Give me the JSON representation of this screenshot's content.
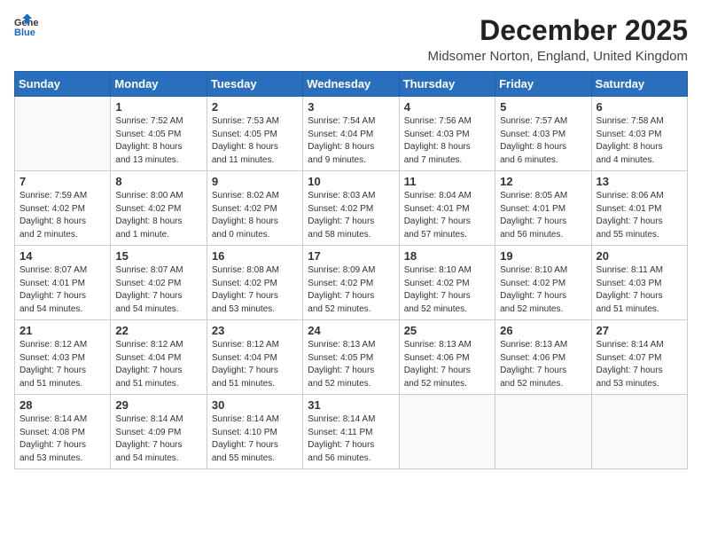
{
  "logo": {
    "general": "General",
    "blue": "Blue"
  },
  "header": {
    "month": "December 2025",
    "location": "Midsomer Norton, England, United Kingdom"
  },
  "weekdays": [
    "Sunday",
    "Monday",
    "Tuesday",
    "Wednesday",
    "Thursday",
    "Friday",
    "Saturday"
  ],
  "weeks": [
    [
      {
        "date": "",
        "info": ""
      },
      {
        "date": "1",
        "info": "Sunrise: 7:52 AM\nSunset: 4:05 PM\nDaylight: 8 hours\nand 13 minutes."
      },
      {
        "date": "2",
        "info": "Sunrise: 7:53 AM\nSunset: 4:05 PM\nDaylight: 8 hours\nand 11 minutes."
      },
      {
        "date": "3",
        "info": "Sunrise: 7:54 AM\nSunset: 4:04 PM\nDaylight: 8 hours\nand 9 minutes."
      },
      {
        "date": "4",
        "info": "Sunrise: 7:56 AM\nSunset: 4:03 PM\nDaylight: 8 hours\nand 7 minutes."
      },
      {
        "date": "5",
        "info": "Sunrise: 7:57 AM\nSunset: 4:03 PM\nDaylight: 8 hours\nand 6 minutes."
      },
      {
        "date": "6",
        "info": "Sunrise: 7:58 AM\nSunset: 4:03 PM\nDaylight: 8 hours\nand 4 minutes."
      }
    ],
    [
      {
        "date": "7",
        "info": "Sunrise: 7:59 AM\nSunset: 4:02 PM\nDaylight: 8 hours\nand 2 minutes."
      },
      {
        "date": "8",
        "info": "Sunrise: 8:00 AM\nSunset: 4:02 PM\nDaylight: 8 hours\nand 1 minute."
      },
      {
        "date": "9",
        "info": "Sunrise: 8:02 AM\nSunset: 4:02 PM\nDaylight: 8 hours\nand 0 minutes."
      },
      {
        "date": "10",
        "info": "Sunrise: 8:03 AM\nSunset: 4:02 PM\nDaylight: 7 hours\nand 58 minutes."
      },
      {
        "date": "11",
        "info": "Sunrise: 8:04 AM\nSunset: 4:01 PM\nDaylight: 7 hours\nand 57 minutes."
      },
      {
        "date": "12",
        "info": "Sunrise: 8:05 AM\nSunset: 4:01 PM\nDaylight: 7 hours\nand 56 minutes."
      },
      {
        "date": "13",
        "info": "Sunrise: 8:06 AM\nSunset: 4:01 PM\nDaylight: 7 hours\nand 55 minutes."
      }
    ],
    [
      {
        "date": "14",
        "info": "Sunrise: 8:07 AM\nSunset: 4:01 PM\nDaylight: 7 hours\nand 54 minutes."
      },
      {
        "date": "15",
        "info": "Sunrise: 8:07 AM\nSunset: 4:02 PM\nDaylight: 7 hours\nand 54 minutes."
      },
      {
        "date": "16",
        "info": "Sunrise: 8:08 AM\nSunset: 4:02 PM\nDaylight: 7 hours\nand 53 minutes."
      },
      {
        "date": "17",
        "info": "Sunrise: 8:09 AM\nSunset: 4:02 PM\nDaylight: 7 hours\nand 52 minutes."
      },
      {
        "date": "18",
        "info": "Sunrise: 8:10 AM\nSunset: 4:02 PM\nDaylight: 7 hours\nand 52 minutes."
      },
      {
        "date": "19",
        "info": "Sunrise: 8:10 AM\nSunset: 4:02 PM\nDaylight: 7 hours\nand 52 minutes."
      },
      {
        "date": "20",
        "info": "Sunrise: 8:11 AM\nSunset: 4:03 PM\nDaylight: 7 hours\nand 51 minutes."
      }
    ],
    [
      {
        "date": "21",
        "info": "Sunrise: 8:12 AM\nSunset: 4:03 PM\nDaylight: 7 hours\nand 51 minutes."
      },
      {
        "date": "22",
        "info": "Sunrise: 8:12 AM\nSunset: 4:04 PM\nDaylight: 7 hours\nand 51 minutes."
      },
      {
        "date": "23",
        "info": "Sunrise: 8:12 AM\nSunset: 4:04 PM\nDaylight: 7 hours\nand 51 minutes."
      },
      {
        "date": "24",
        "info": "Sunrise: 8:13 AM\nSunset: 4:05 PM\nDaylight: 7 hours\nand 52 minutes."
      },
      {
        "date": "25",
        "info": "Sunrise: 8:13 AM\nSunset: 4:06 PM\nDaylight: 7 hours\nand 52 minutes."
      },
      {
        "date": "26",
        "info": "Sunrise: 8:13 AM\nSunset: 4:06 PM\nDaylight: 7 hours\nand 52 minutes."
      },
      {
        "date": "27",
        "info": "Sunrise: 8:14 AM\nSunset: 4:07 PM\nDaylight: 7 hours\nand 53 minutes."
      }
    ],
    [
      {
        "date": "28",
        "info": "Sunrise: 8:14 AM\nSunset: 4:08 PM\nDaylight: 7 hours\nand 53 minutes."
      },
      {
        "date": "29",
        "info": "Sunrise: 8:14 AM\nSunset: 4:09 PM\nDaylight: 7 hours\nand 54 minutes."
      },
      {
        "date": "30",
        "info": "Sunrise: 8:14 AM\nSunset: 4:10 PM\nDaylight: 7 hours\nand 55 minutes."
      },
      {
        "date": "31",
        "info": "Sunrise: 8:14 AM\nSunset: 4:11 PM\nDaylight: 7 hours\nand 56 minutes."
      },
      {
        "date": "",
        "info": ""
      },
      {
        "date": "",
        "info": ""
      },
      {
        "date": "",
        "info": ""
      }
    ]
  ]
}
